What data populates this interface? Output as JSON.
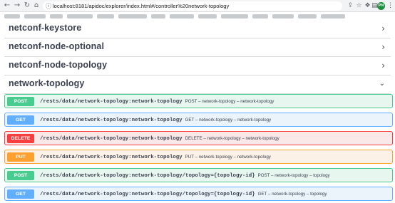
{
  "browser": {
    "url": "localhost:8181/apidoc/explorer/index.html#/controller%20network-topology",
    "avatar_initials": "PN"
  },
  "tags": [
    {
      "name": "netconf-keystore",
      "expanded": false
    },
    {
      "name": "netconf-node-optional",
      "expanded": false
    },
    {
      "name": "netconf-node-topology",
      "expanded": false
    },
    {
      "name": "network-topology",
      "expanded": true
    }
  ],
  "operations": [
    {
      "method": "POST",
      "path": "/rests/data/network-topology:network-topology",
      "summary": "POST – network-topology – network-topology"
    },
    {
      "method": "GET",
      "path": "/rests/data/network-topology:network-topology",
      "summary": "GET – network-topology – network-topology"
    },
    {
      "method": "DELETE",
      "path": "/rests/data/network-topology:network-topology",
      "summary": "DELETE – network-topology – network-topology"
    },
    {
      "method": "PUT",
      "path": "/rests/data/network-topology:network-topology",
      "summary": "PUT – network-topology – network-topology"
    },
    {
      "method": "POST",
      "path": "/rests/data/network-topology:network-topology/topology={topology-id}",
      "summary": "POST – network-topology – topology"
    },
    {
      "method": "GET",
      "path": "/rests/data/network-topology:network-topology/topology={topology-id}",
      "summary": "GET – network-topology – topology"
    }
  ],
  "icons": {
    "back": "arrow-left-icon",
    "forward": "arrow-right-icon",
    "reload": "reload-icon",
    "home": "home-icon",
    "lock": "lock-icon",
    "share": "share-icon",
    "bookmark": "star-icon",
    "extensions": "puzzle-icon",
    "menu": "sidebar-icon",
    "collapsed": "chevron-right-icon",
    "expanded": "chevron-down-icon"
  },
  "colors": {
    "post": "#49cc90",
    "get": "#61affe",
    "delete": "#f93e3e",
    "put": "#fca130"
  }
}
